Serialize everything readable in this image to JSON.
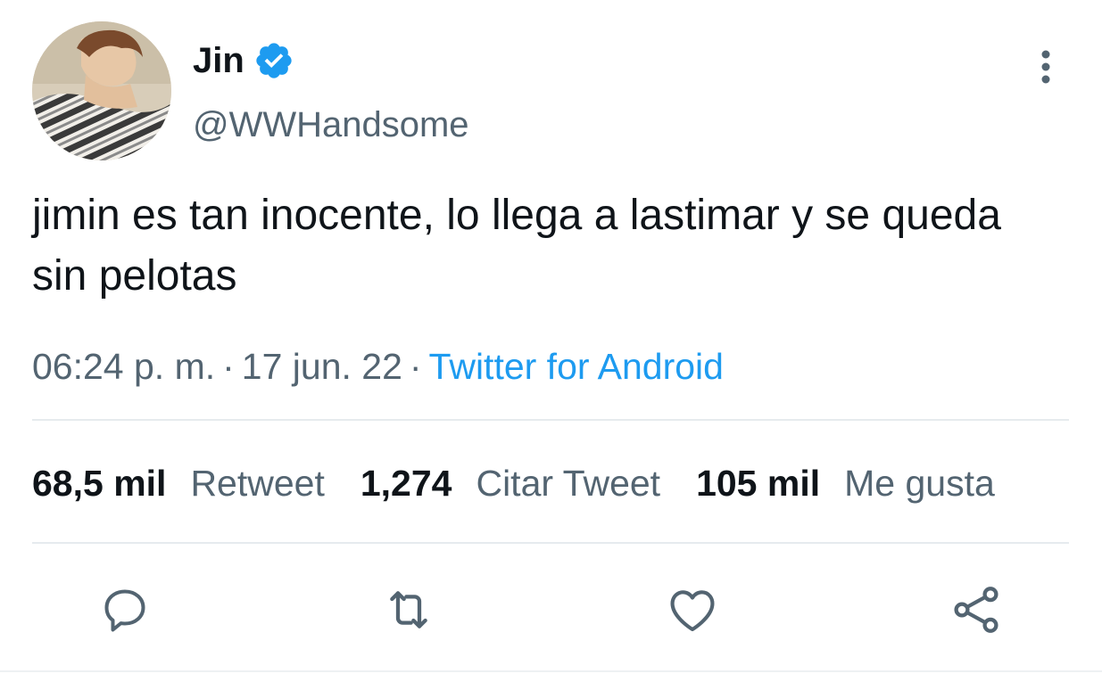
{
  "author": {
    "name": "Jin",
    "handle": "@WWHandsome",
    "verified": true,
    "avatar_icon": "profile-photo"
  },
  "tweet": {
    "text": "jimin es tan inocente, lo llega a lastimar y se queda sin pelotas",
    "time": "06:24 p. m.",
    "separator": "·",
    "date": "17 jun. 22",
    "source": "Twitter for Android"
  },
  "stats": [
    {
      "count": "68,5 mil",
      "label": "Retweet"
    },
    {
      "count": "1,274",
      "label": "Citar Tweet"
    },
    {
      "count": "105 mil",
      "label": "Me gusta"
    }
  ],
  "actions": [
    {
      "icon": "reply-icon"
    },
    {
      "icon": "retweet-icon"
    },
    {
      "icon": "like-icon"
    },
    {
      "icon": "share-icon"
    }
  ],
  "colors": {
    "text": "#0f1419",
    "secondary": "#536471",
    "accent": "#1d9bf0",
    "divider": "#e6ebee"
  }
}
